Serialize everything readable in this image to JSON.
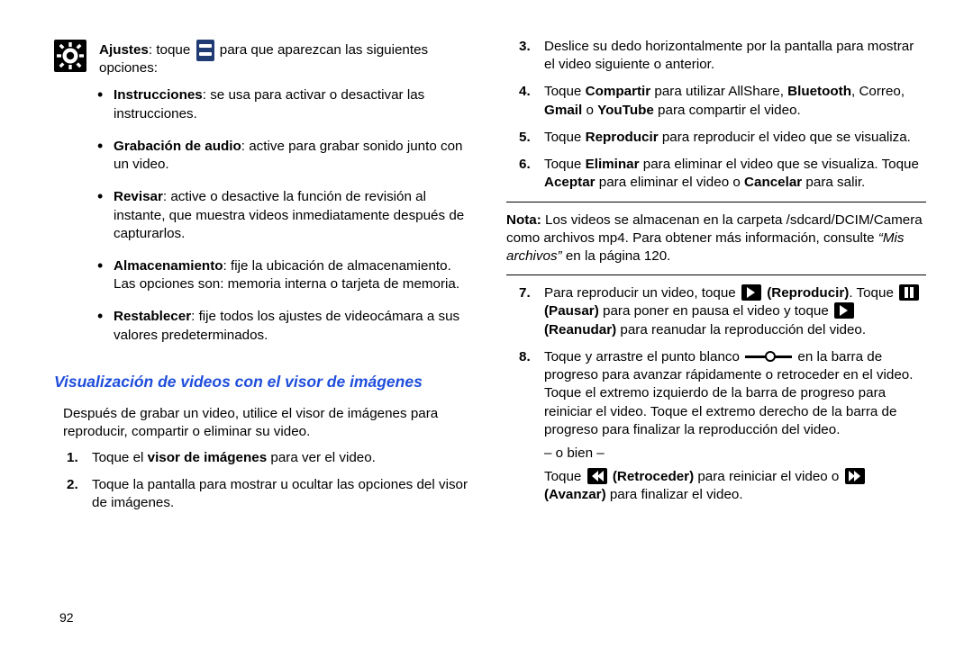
{
  "left": {
    "ajustes_label": "Ajustes",
    "ajustes_colon": ": toque ",
    "ajustes_tail": " para que aparezcan las siguientes opciones:",
    "bullets": [
      {
        "title": "Instrucciones",
        "rest": ": se usa para activar o desactivar las instrucciones."
      },
      {
        "title": "Grabación de audio",
        "rest": ": active para grabar sonido junto con un video."
      },
      {
        "title": "Revisar",
        "rest": ": active o desactive la función de revisión al instante, que muestra videos inmediatamente después de capturarlos."
      },
      {
        "title": "Almacenamiento",
        "rest": ": fije la ubicación de almacenamiento. Las opciones son: memoria interna o tarjeta de memoria."
      },
      {
        "title": "Restablecer",
        "rest": ": fije todos los ajustes de videocámara a sus valores predeterminados."
      }
    ],
    "heading": "Visualización de videos con el visor de imágenes",
    "intro": "Después de grabar un video, utilice el visor de imágenes para reproducir, compartir o eliminar su video.",
    "steps": [
      {
        "num": "1.",
        "pre": "Toque el ",
        "bold1": "visor de imágenes",
        "tail": " para ver el video."
      },
      {
        "num": "2.",
        "plain": "Toque la pantalla para mostrar u ocultar las opciones del visor de imágenes."
      }
    ]
  },
  "right": {
    "steps_a": [
      {
        "num": "3.",
        "plain": "Deslice su dedo horizontalmente por la pantalla para mostrar el video siguiente o anterior."
      },
      {
        "num": "4.",
        "pre": "Toque ",
        "b1": "Compartir",
        "mid1": " para utilizar AllShare, ",
        "b2": "Bluetooth",
        "mid2": ", Correo, ",
        "b3": "Gmail",
        "mid3": " o ",
        "b4": "YouTube",
        "tail": " para compartir el video."
      },
      {
        "num": "5.",
        "pre": "Toque ",
        "b1": "Reproducir",
        "tail": " para reproducir el video que se visualiza."
      },
      {
        "num": "6.",
        "pre": "Toque ",
        "b1": "Eliminar",
        "mid1": " para eliminar el video que se visualiza. Toque ",
        "b2": "Aceptar",
        "mid2": " para eliminar el video o ",
        "b3": "Cancelar",
        "tail": " para salir."
      }
    ],
    "note_label": "Nota:",
    "note_body_pre": " Los videos se almacenan en la carpeta /sdcard/DCIM/Camera como archivos mp4. Para obtener más información, consulte ",
    "note_ref": "“Mis archivos”",
    "note_body_post": " en la página 120.",
    "step7": {
      "num": "7.",
      "pre": "Para reproducir un video, toque ",
      "b_play": " (Reproducir)",
      "mid1": ". Toque ",
      "b_pause": " (Pausar)",
      "mid2": " para poner en pausa el video y toque ",
      "b_resume": "(Reanudar)",
      "tail": " para reanudar la reproducción del video."
    },
    "step8": {
      "num": "8.",
      "pre": "Toque y arrastre el punto blanco ",
      "mid1": " en la barra de progreso para avanzar rápidamente o retroceder en el video. Toque el extremo izquierdo de la barra de progreso para reiniciar el video. Toque el extremo derecho de la barra de progreso para finalizar la reproducción del video.",
      "or": "– o bien –",
      "pre2": "Toque ",
      "brw": " (Retroceder)",
      "mid2": " para reiniciar el video o ",
      "bff": "(Avanzar)",
      "tail2": " para finalizar el video."
    }
  },
  "pagenum": "92"
}
